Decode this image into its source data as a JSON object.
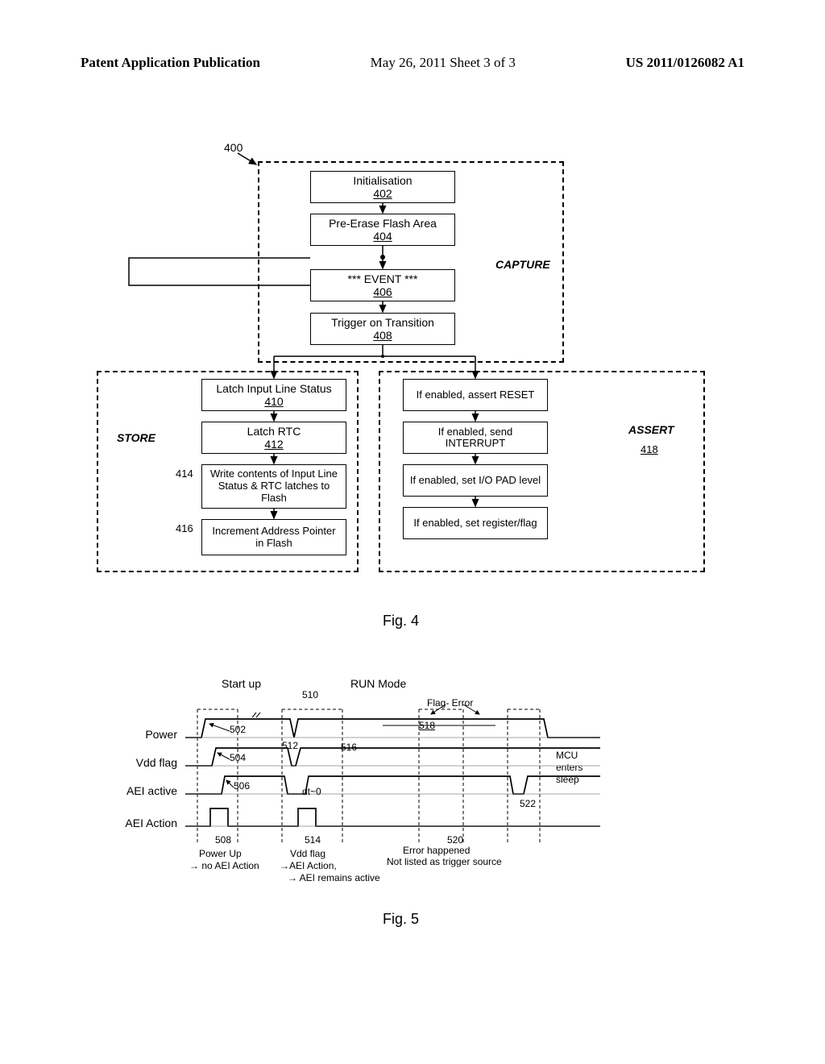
{
  "header": {
    "left": "Patent Application Publication",
    "center": "May 26, 2011  Sheet 3 of 3",
    "right": "US 2011/0126082 A1"
  },
  "fig4": {
    "ref": "400",
    "phase_capture": "CAPTURE",
    "phase_store": "STORE",
    "phase_assert": "ASSERT",
    "phase_assert_num": "418",
    "boxes": {
      "init_label": "Initialisation",
      "init_num": "402",
      "erase_label": "Pre-Erase Flash Area",
      "erase_num": "404",
      "event_label": "*** EVENT ***",
      "event_num": "406",
      "trigger_label": "Trigger on Transition",
      "trigger_num": "408",
      "latch_in_label": "Latch Input Line Status",
      "latch_in_num": "410",
      "latch_rtc_label": "Latch RTC",
      "latch_rtc_num": "412",
      "write_label": "Write contents of Input Line Status & RTC latches to Flash",
      "write_num": "414",
      "inc_label": "Increment Address Pointer in Flash",
      "inc_num": "416",
      "reset_label": "If enabled, assert RESET",
      "int_label": "If enabled, send INTERRUPT",
      "pad_label": "If enabled, set I/O PAD level",
      "flag_label": "If enabled, set register/flag"
    },
    "caption": "Fig. 4"
  },
  "fig5": {
    "top": {
      "startup": "Start up",
      "run": "RUN Mode"
    },
    "rows": {
      "power": "Power",
      "vdd": "Vdd flag",
      "aei_active": "AEI active",
      "aei_action": "AEI Action"
    },
    "flag_error": "Flag- Error",
    "sleep_line1": "MCU",
    "sleep_line2": "enters",
    "sleep_line3": "sleep",
    "nums": {
      "n502": "502",
      "n504": "504",
      "n506": "506",
      "n508": "508",
      "n510": "510",
      "n512": "512",
      "n514": "514",
      "n516": "516",
      "n518": "518",
      "n520": "520",
      "n522": "522"
    },
    "notes": {
      "pu1": "Power Up",
      "pu2": "→ no AEI Action",
      "vf1": "Vdd flag",
      "vf2": "→AEI Action,",
      "vf3": "→ AEI remains active",
      "err1": "Error happened",
      "err2": "Not listed as trigger source",
      "dt": "dt~0"
    },
    "caption": "Fig. 5"
  }
}
